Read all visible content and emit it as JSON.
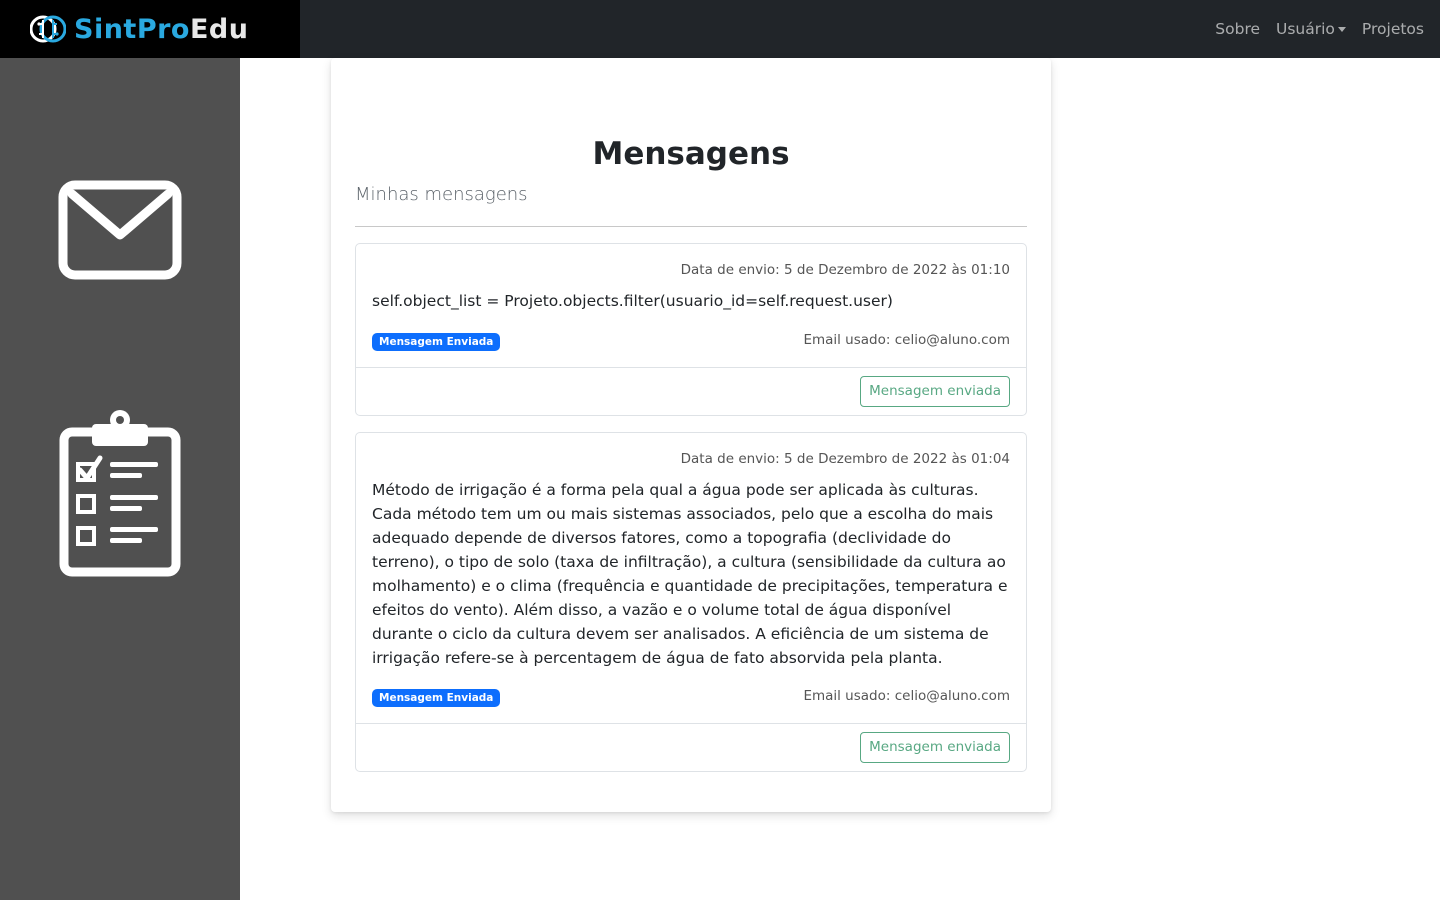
{
  "brand": {
    "name_part1": "SintPro",
    "name_part2": "Edu",
    "logo_icon": "brain-circuit-icon"
  },
  "nav": {
    "items": [
      {
        "label": "Sobre"
      },
      {
        "label": "Usuário",
        "dropdown": true
      },
      {
        "label": "Projetos"
      }
    ]
  },
  "sidebar": {
    "items": [
      {
        "icon": "envelope-icon"
      },
      {
        "icon": "clipboard-checklist-icon"
      }
    ]
  },
  "page": {
    "title": "Mensagens",
    "subtitle": "Minhas mensagens"
  },
  "messages": [
    {
      "date": "Data de envio: 5 de Dezembro de 2022 às 01:10",
      "text": "self.object_list = Projeto.objects.filter(usuario_id=self.request.user)",
      "badge": "Mensagem Enviada",
      "email": "Email usado: celio@aluno.com",
      "button": "Mensagem enviada"
    },
    {
      "date": "Data de envio: 5 de Dezembro de 2022 às 01:04",
      "text": "Método de irrigação é a forma pela qual a água pode ser aplicada às culturas. Cada método tem um ou mais sistemas associados, pelo que a escolha do mais adequado depende de diversos fatores, como a topografia (declividade do terreno), o tipo de solo (taxa de infiltração), a cultura (sensibilidade da cultura ao molhamento) e o clima (frequência e quantidade de precipitações, temperatura e efeitos do vento). Além disso, a vazão e o volume total de água disponível durante o ciclo da cultura devem ser analisados. A eficiência de um sistema de irrigação refere-se à percentagem de água de fato absorvida pela planta.",
      "badge": "Mensagem Enviada",
      "email": "Email usado: celio@aluno.com",
      "button": "Mensagem enviada"
    }
  ],
  "colors": {
    "navbar": "#212529",
    "sidebar": "#505050",
    "brand_accent": "#2aa9e0",
    "badge": "#0d6efd",
    "button_outline": "#198754"
  }
}
